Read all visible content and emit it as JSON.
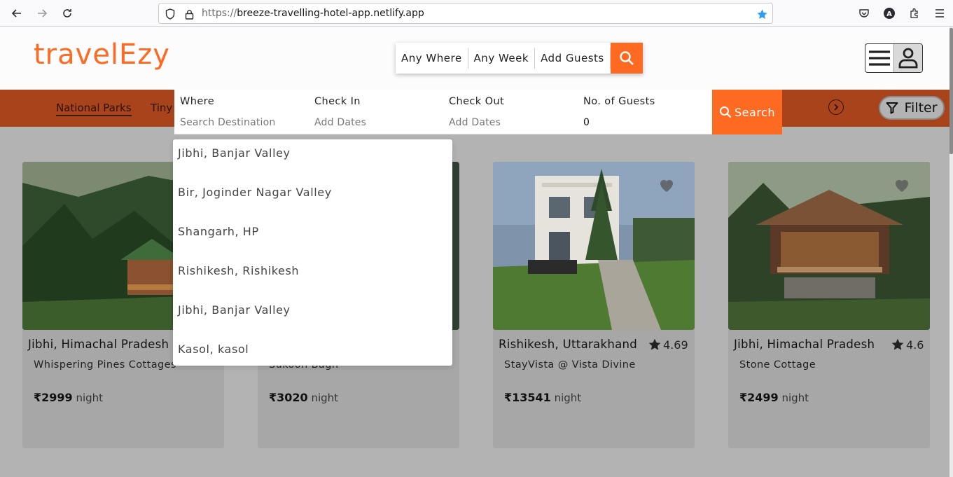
{
  "browser": {
    "url_proto": "https://",
    "url_host": "breeze-travelling-hotel-app.netlify.app",
    "profile_initial": "A"
  },
  "header": {
    "logo": "travelEzy",
    "pill": [
      "Any Where",
      "Any Week",
      "Add Guests"
    ]
  },
  "categories": [
    "National Parks",
    "Tiny"
  ],
  "filter_label": "Filter",
  "search_panel": {
    "where_label": "Where",
    "where_placeholder": "Search Destination",
    "checkin_label": "Check In",
    "checkin_value": "Add Dates",
    "checkout_label": "Check Out",
    "checkout_value": "Add Dates",
    "guests_label": "No. of Guests",
    "guests_value": "0",
    "search_label": "Search"
  },
  "dropdown": [
    "Jibhi, Banjar Valley",
    "Bir, Joginder Nagar Valley",
    "Shangarh, HP",
    "Rishikesh, Rishikesh",
    "Jibhi, Banjar Valley",
    "Kasol, kasol"
  ],
  "cards": [
    {
      "location": "Jibhi, Himachal Pradesh",
      "rating": "",
      "name": "Whispering Pines Cottages",
      "price": "₹2999",
      "unit": " night"
    },
    {
      "location": "",
      "rating": "",
      "name": "Sukoon Bagh",
      "price": "₹3020",
      "unit": " night"
    },
    {
      "location": "Rishikesh, Uttarakhand",
      "rating": "4.69",
      "name": "StayVista @ Vista Divine",
      "price": "₹13541",
      "unit": " night"
    },
    {
      "location": "Jibhi, Himachal Pradesh",
      "rating": "4.6",
      "name": "Stone Cottage",
      "price": "₹2499",
      "unit": " night"
    }
  ],
  "colors": {
    "brand": "#ff6a22",
    "category_bar": "#a8431b",
    "overlay": "#b3b3b3"
  }
}
